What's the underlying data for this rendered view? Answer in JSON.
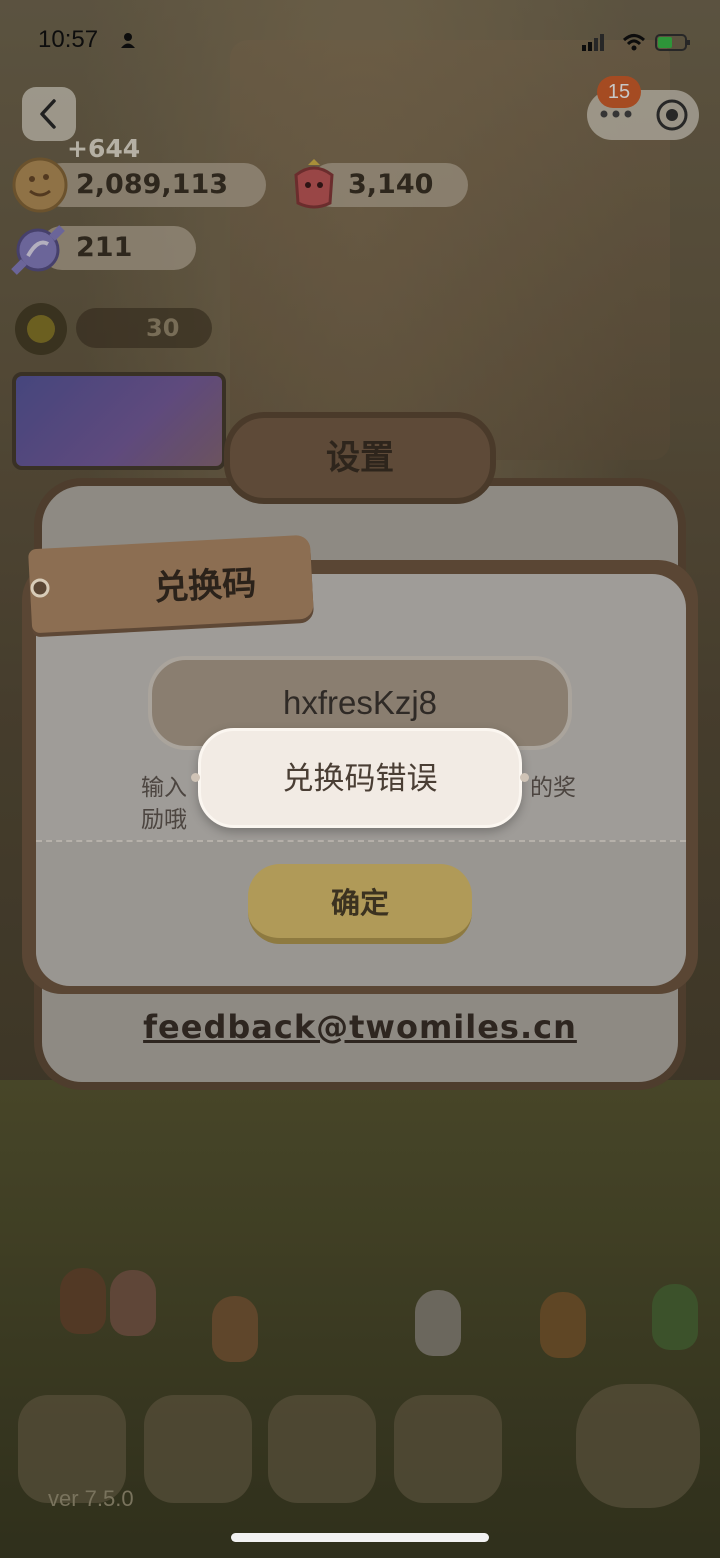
{
  "status_bar": {
    "time": "10:57"
  },
  "top_bar": {
    "notification_count": "15"
  },
  "currency": {
    "delta": "+644",
    "cookies": "2,089,113",
    "gems": "3,140",
    "candy": "211",
    "sun_count": "30"
  },
  "settings": {
    "title": "设置",
    "feedback_email": "feedback@twomiles.cn"
  },
  "redeem": {
    "title": "兑换码",
    "code_value": "hxfresKzj8",
    "hint_start": "输入",
    "hint_end": "的奖",
    "hint_line2": "励哦",
    "confirm_label": "确定"
  },
  "toast": {
    "message": "兑换码错误"
  },
  "footer": {
    "version": "ver 7.5.0"
  },
  "colors": {
    "toast_bg": "#f2ebe4",
    "confirm_button": "#b09a58",
    "badge": "#d4602c"
  }
}
